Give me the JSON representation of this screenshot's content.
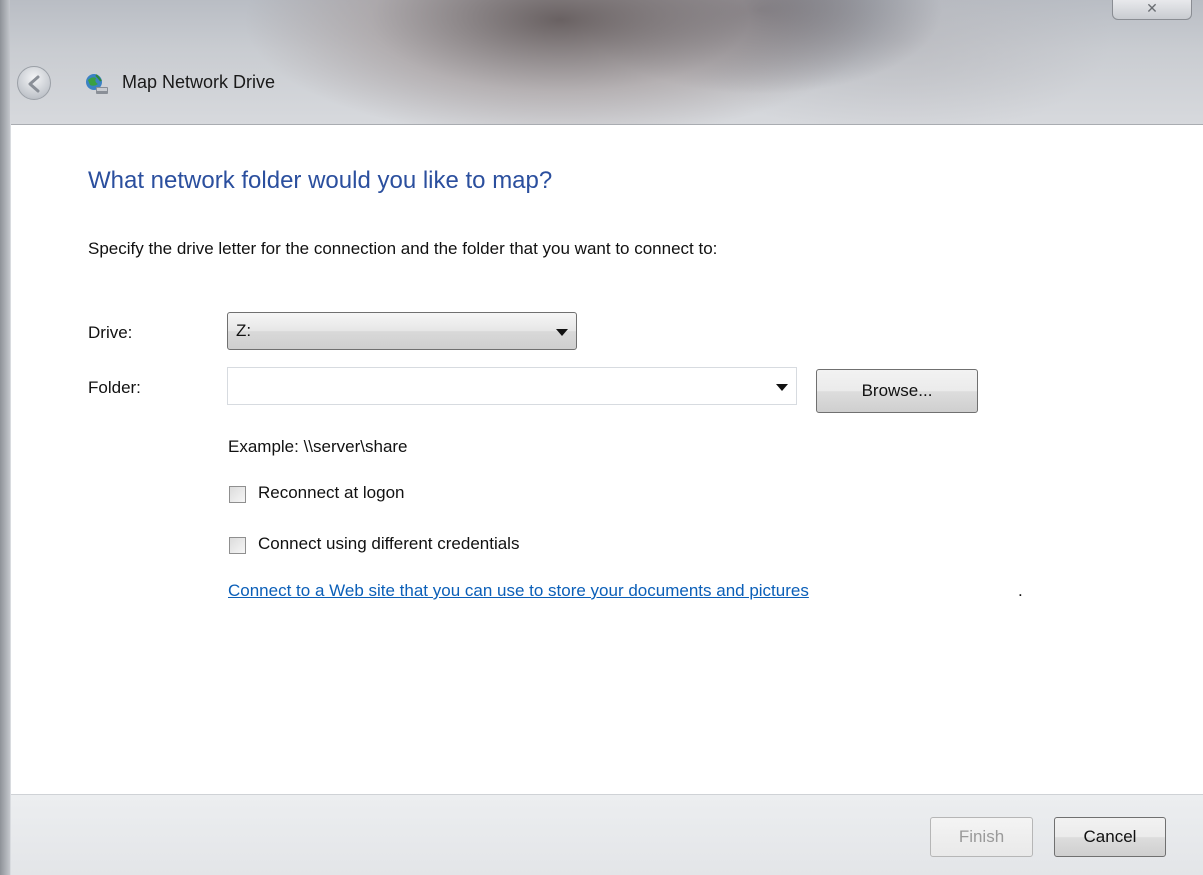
{
  "window": {
    "title": "Map Network Drive",
    "close_glyph": "✕",
    "back_icon": "back-arrow-icon",
    "title_icon": "network-drive-icon"
  },
  "main": {
    "heading": "What network folder would you like to map?",
    "instruction": "Specify the drive letter for the connection and the folder that you want to connect to:",
    "drive_label": "Drive:",
    "drive_value": "Z:",
    "folder_label": "Folder:",
    "folder_value": "",
    "browse_label": "Browse...",
    "example": "Example: \\\\server\\share",
    "reconnect_label": "Reconnect at logon",
    "reconnect_checked": false,
    "credentials_label": "Connect using different credentials",
    "credentials_checked": false,
    "web_link": "Connect to a Web site that you can use to store your documents and pictures",
    "web_link_suffix": "."
  },
  "footer": {
    "finish_label": "Finish",
    "finish_enabled": false,
    "cancel_label": "Cancel"
  },
  "colors": {
    "heading": "#2b4f9e",
    "link": "#0b5fb8"
  }
}
